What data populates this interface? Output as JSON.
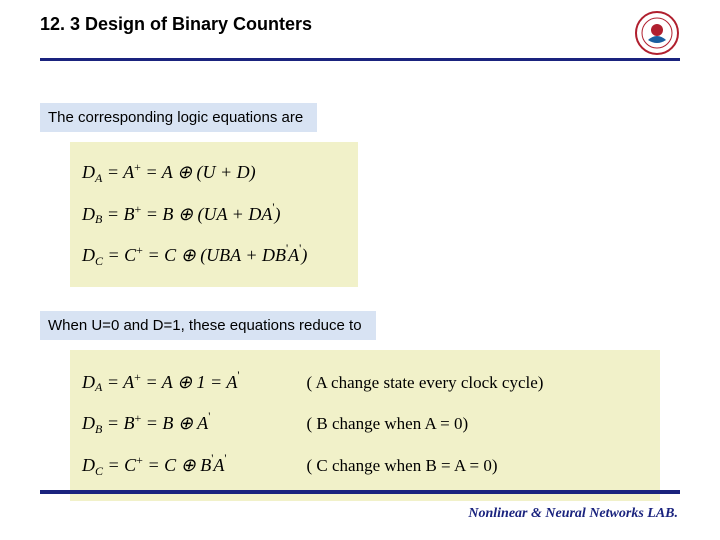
{
  "header": {
    "title": "12. 3 Design of Binary Counters",
    "logo_alt": "university-seal"
  },
  "caption1": "The corresponding logic equations are",
  "eq1": {
    "line1_lhs": "D",
    "line1_sub": "A",
    "line1_eq1": " = A",
    "line1_sup": "+",
    "line1_eq2": " = A ⊕ (U + D)",
    "line2_lhs": "D",
    "line2_sub": "B",
    "line2_eq1": " = B",
    "line2_sup": "+",
    "line2_eq2": " = B ⊕ (UA + DA",
    "line2_tail": ")",
    "line3_lhs": "D",
    "line3_sub": "C",
    "line3_eq1": " = C",
    "line3_sup": "+",
    "line3_eq2": " = C ⊕ (UBA + DB",
    "line3_mid": "A",
    "line3_tail": ")"
  },
  "caption2": "When U=0 and D=1, these equations reduce to",
  "eq2": {
    "l1_a": "D",
    "l1_sub": "A",
    "l1_b": " = A",
    "l1_sup": "+",
    "l1_c": " = A ⊕ 1 = A",
    "l1_comment": "(  A change state every clock cycle)",
    "l2_a": "D",
    "l2_sub": "B",
    "l2_b": " = B",
    "l2_sup": "+",
    "l2_c": " = B ⊕ A",
    "l2_comment": "( B change when A = 0)",
    "l3_a": "D",
    "l3_sub": "C",
    "l3_b": " = C",
    "l3_sup": "+",
    "l3_c": " = C ⊕ B",
    "l3_mid": "A",
    "l3_comment": "( C change when B = A = 0)"
  },
  "footer": "Nonlinear & Neural Networks LAB."
}
